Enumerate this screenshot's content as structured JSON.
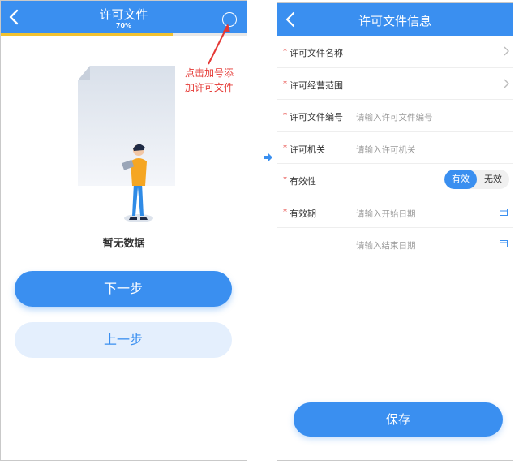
{
  "left_screen": {
    "title": "许可文件",
    "progress_text": "70%",
    "progress_value": 0.7,
    "empty_text": "暂无数据",
    "next_button": "下一步",
    "prev_button": "上一步",
    "annotation": "点击加号添加许可文件",
    "icons": [
      "back-icon",
      "add-icon",
      "empty-document-illustration"
    ]
  },
  "right_screen": {
    "title": "许可文件信息",
    "fields": [
      {
        "label": "许可文件名称",
        "required": "*",
        "placeholder": "",
        "control": "chevron"
      },
      {
        "label": "许可经营范围",
        "required": "*",
        "placeholder": "",
        "control": "chevron"
      },
      {
        "label": "许可文件编号",
        "required": "*",
        "placeholder": "请输入许可文件编号",
        "control": "none"
      },
      {
        "label": "许可机关",
        "required": "*",
        "placeholder": "请输入许可机关",
        "control": "none"
      },
      {
        "label": "有效性",
        "required": "*",
        "placeholder": "",
        "control": "toggle"
      },
      {
        "label": "有效期",
        "required": "*",
        "placeholder": "请输入开始日期",
        "control": "calendar"
      },
      {
        "label": "",
        "required": "",
        "placeholder": "请输入结束日期",
        "control": "calendar"
      }
    ],
    "toggle": {
      "on": "有效",
      "off": "无效"
    },
    "save_button": "保存"
  },
  "colors": {
    "primary": "#3a8ff0",
    "progress": "#f2c22f",
    "annotation": "#e53935",
    "light_button": "#e4effd"
  }
}
